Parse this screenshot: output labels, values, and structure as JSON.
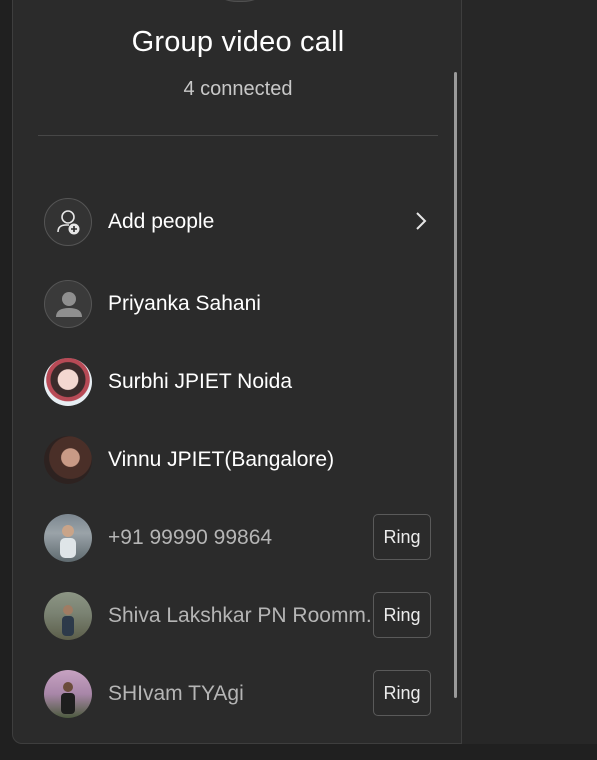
{
  "header": {
    "title": "Group video call",
    "subtitle": "4 connected"
  },
  "add_people": {
    "label": "Add people",
    "icon": "person-add-icon"
  },
  "participants": [
    {
      "name": "Priyanka Sahani",
      "avatar": "default-avatar"
    },
    {
      "name": "Surbhi JPIET Noida",
      "avatar": "photo-avatar"
    },
    {
      "name": "Vinnu JPIET(Bangalore)",
      "avatar": "photo-avatar"
    },
    {
      "name": "+91 99990 99864",
      "avatar": "photo-avatar",
      "action": "Ring"
    },
    {
      "name": "Shiva Lakshkar PN Roomm...",
      "avatar": "photo-avatar",
      "action": "Ring"
    },
    {
      "name": "SHIvam TYAgi",
      "avatar": "photo-avatar",
      "action": "Ring"
    }
  ],
  "colors": {
    "panel": "#2b2b2b",
    "background": "#202020",
    "text_primary": "#ffffff",
    "text_dim": "#b5b5b5"
  }
}
